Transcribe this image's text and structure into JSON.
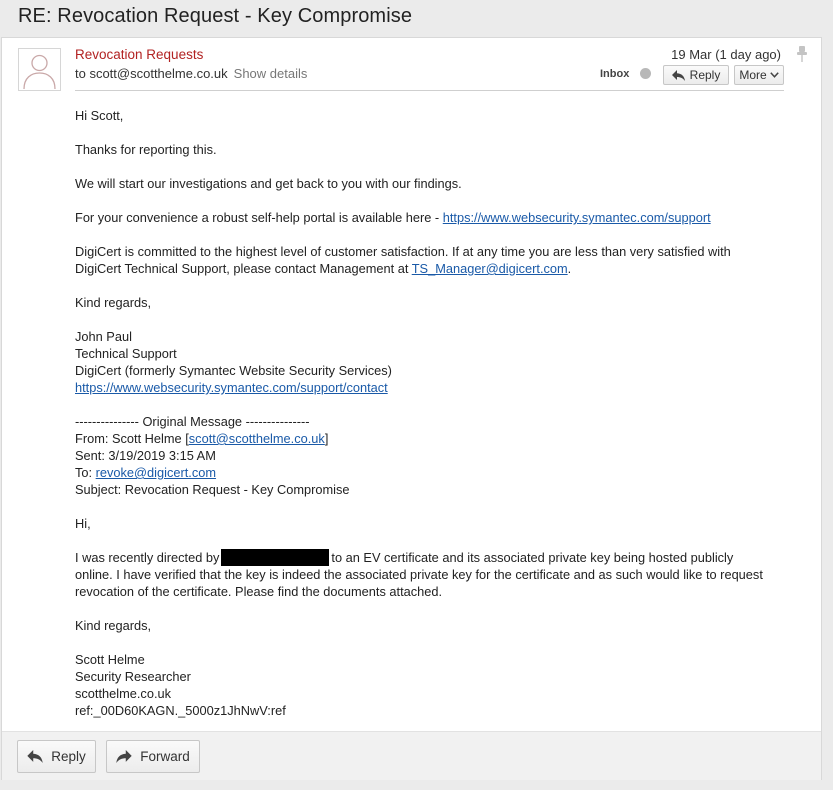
{
  "subject": "RE: Revocation Request - Key Compromise",
  "header": {
    "from_name": "Revocation Requests",
    "to": "to scott@scotthelme.co.uk",
    "show_details": "Show details",
    "date": "19 Mar (1 day ago)",
    "folder": "Inbox",
    "reply_label": "Reply",
    "more_label": "More"
  },
  "body": {
    "greeting": "Hi Scott,",
    "p1": "Thanks for reporting this.",
    "p2": "We will start our investigations and get back to you with our findings.",
    "p3_text": "For your convenience a robust self-help portal is available here - ",
    "p3_link": "https://www.websecurity.symantec.com/support",
    "p4_line1": "DigiCert is committed to the highest level of customer satisfaction. If at any time you are less than very satisfied with",
    "p4_line2_text": "DigiCert Technical Support, please contact Management at ",
    "p4_link": "TS_Manager@digicert.com",
    "p4_end": ".",
    "sign_off": "Kind regards,",
    "sig_name": "John Paul",
    "sig_title": "Technical Support",
    "sig_company": "DigiCert (formerly Symantec Website Security Services)",
    "sig_link": "https://www.websecurity.symantec.com/support/contact",
    "orig_header": "--------------- Original Message ---------------",
    "orig_from_label": "From: Scott Helme [",
    "orig_from_link": "scott@scotthelme.co.uk",
    "orig_from_end": "]",
    "orig_sent": "Sent: 3/19/2019 3:15 AM",
    "orig_to_label": "To: ",
    "orig_to_link": "revoke@digicert.com",
    "orig_subject": "Subject: Revocation Request - Key Compromise",
    "orig_greeting": "Hi,",
    "orig_p1_a": "I was recently directed by",
    "orig_p1_b": "to an EV certificate and its associated private key being hosted publicly",
    "orig_p1_line2": "online. I have verified that the key is indeed the associated private key for the certificate and as such would like to request",
    "orig_p1_line3": "revocation of the certificate. Please find the documents attached.",
    "orig_sign_off": "Kind regards,",
    "orig_sig_name": "Scott Helme",
    "orig_sig_title": "Security Researcher",
    "orig_sig_site": "scotthelme.co.uk",
    "ref": "ref:_00D60KAGN._5000z1JhNwV:ref"
  },
  "footer": {
    "reply_label": "Reply",
    "forward_label": "Forward"
  },
  "colors": {
    "sender": "#b22222",
    "link": "#1a5aa8",
    "background": "#ebebeb"
  },
  "icons": [
    "avatar-icon",
    "pin-icon",
    "reply-icon",
    "chevron-down-icon",
    "forward-icon"
  ]
}
